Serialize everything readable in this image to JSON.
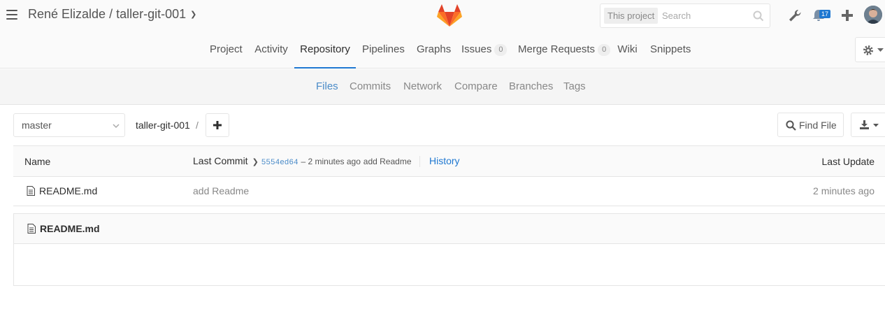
{
  "header": {
    "project_title": "René Elizalde / taller-git-001",
    "search": {
      "scope": "This project",
      "placeholder": "Search"
    },
    "todos_count": "17"
  },
  "nav": {
    "tabs": [
      {
        "label": "Project"
      },
      {
        "label": "Activity"
      },
      {
        "label": "Repository",
        "active": true
      },
      {
        "label": "Pipelines"
      },
      {
        "label": "Graphs"
      },
      {
        "label": "Issues",
        "count": "0"
      },
      {
        "label": "Merge Requests",
        "count": "0"
      },
      {
        "label": "Wiki"
      },
      {
        "label": "Snippets"
      }
    ]
  },
  "subnav": {
    "items": [
      {
        "label": "Files",
        "active": true
      },
      {
        "label": "Commits"
      },
      {
        "label": "Network"
      },
      {
        "label": "Compare"
      },
      {
        "label": "Branches"
      },
      {
        "label": "Tags"
      }
    ]
  },
  "toolbar": {
    "branch": "master",
    "breadcrumb": "taller-git-001",
    "separator": "/",
    "find_file_label": "Find File"
  },
  "tree": {
    "headers": {
      "name": "Name",
      "last_commit": "Last Commit",
      "last_update": "Last Update"
    },
    "last_commit": {
      "sha": "5554ed64",
      "meta": "– 2 minutes ago",
      "message": "add Readme",
      "history_label": "History"
    },
    "rows": [
      {
        "name": "README.md",
        "message": "add Readme",
        "time": "2 minutes ago"
      }
    ]
  },
  "readme": {
    "title": "README.md"
  },
  "colors": {
    "accent": "#1f78d1",
    "link": "#4a8bc8",
    "border": "#e5e5e5"
  }
}
